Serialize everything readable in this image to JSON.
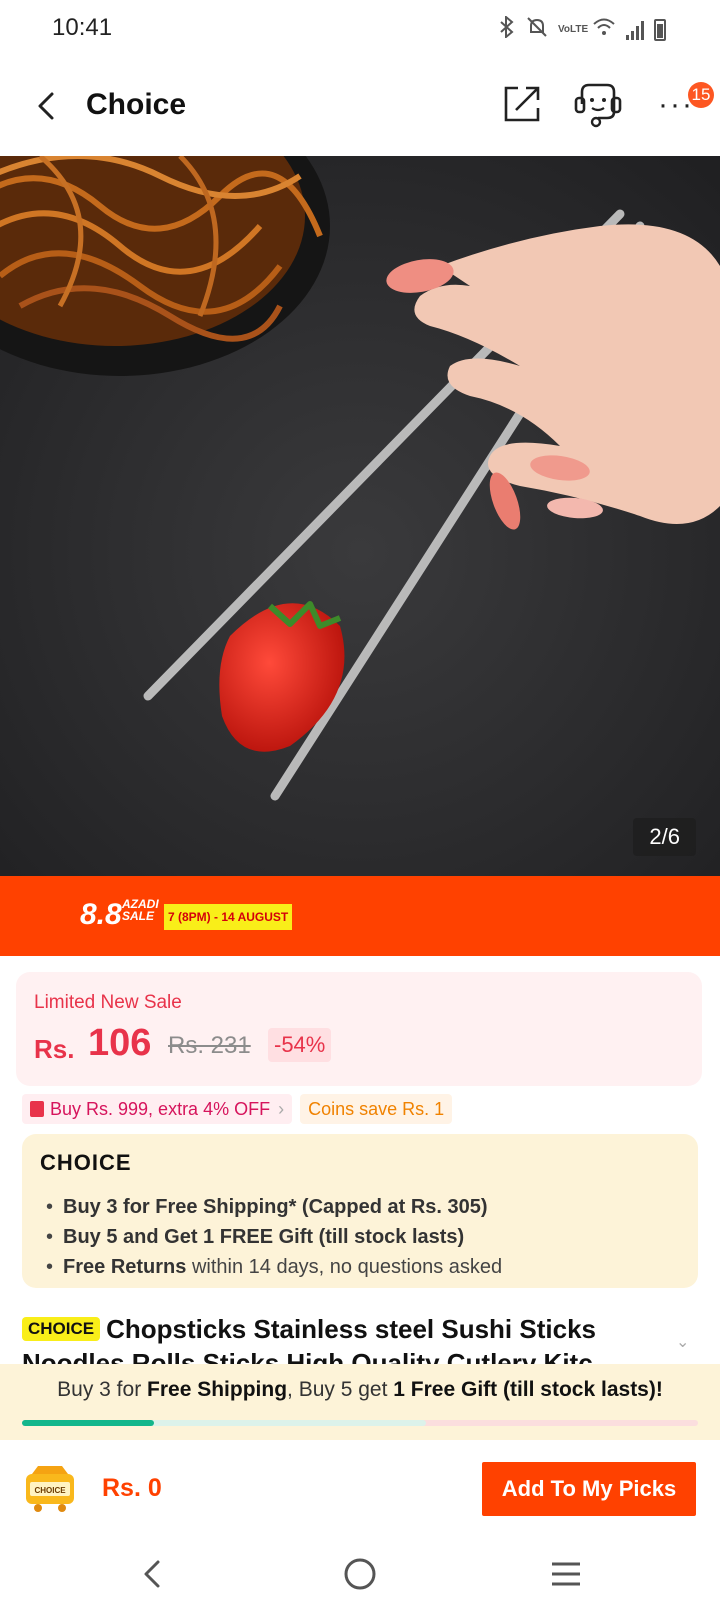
{
  "status_bar": {
    "time": "10:41",
    "network_label": "VoLTE"
  },
  "header": {
    "title": "Choice",
    "notification_count": "15"
  },
  "gallery": {
    "counter": "2/6",
    "icons": [
      "noodle-bowl",
      "hand",
      "chopsticks",
      "strawberry"
    ]
  },
  "sale_banner": {
    "number": "8.8",
    "name": "AZADI SALE",
    "dates": "7 (8PM) - 14 AUGUST"
  },
  "price": {
    "label": "Limited New Sale",
    "currency": "Rs.",
    "value": "106",
    "original": "Rs. 231",
    "discount": "-54%"
  },
  "coupons": {
    "extra_off": "Buy Rs. 999, extra 4% OFF",
    "coins": "Coins save Rs. 1"
  },
  "choice": {
    "logo": "CHOICE",
    "benefits": [
      {
        "bold": "Buy 3 for  Free Shipping* (Capped at Rs. 305)",
        "rest": ""
      },
      {
        "bold": "Buy 5 and Get 1 FREE Gift (till stock lasts)",
        "rest": ""
      },
      {
        "bold": "Free Returns",
        "rest": " within 14 days, no questions asked"
      }
    ]
  },
  "product": {
    "badge": "CHOICE",
    "title": "Chopsticks Stainless steel Sushi Sticks Noodles Rolls Sticks High Quality Cutlery Kitc..."
  },
  "promo": {
    "part1": "Buy 3 for ",
    "bold1": "Free Shipping",
    "part2": ", Buy 5 get ",
    "bold2": "1 Free Gift (till stock lasts)!",
    "progress": 0.195
  },
  "bottom": {
    "cart_label": "CHOICE",
    "total": "Rs. 0",
    "add_button": "Add To My Picks"
  },
  "colors": {
    "brand_orange": "#ff4100",
    "price_red": "#e8334a",
    "choice_yellow": "#f9ee19",
    "progress_green": "#13b68b"
  }
}
